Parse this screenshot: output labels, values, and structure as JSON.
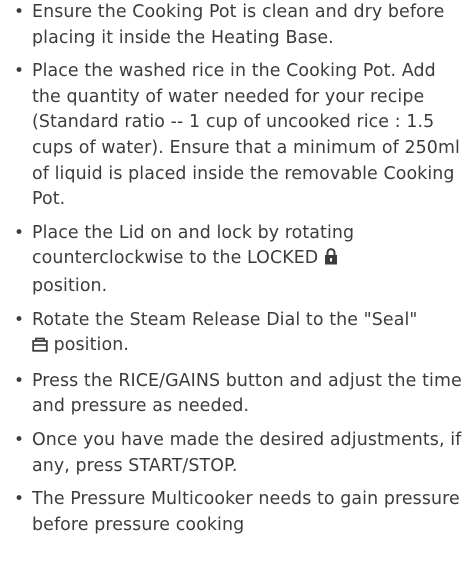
{
  "instructions": [
    {
      "text": "Ensure the Cooking Pot is clean and dry before placing it inside the Heating Base."
    },
    {
      "text": "Place the washed rice in the Cooking Pot. Add the quantity of water needed for your recipe (Standard ratio -- 1 cup of uncooked rice : 1.5 cups of water). Ensure that a minimum of 250ml of liquid is placed inside the removable Cooking Pot."
    },
    {
      "text_before": "Place the Lid on and lock by rotating counterclockwise to the LOCKED",
      "icon": "lock-icon",
      "text_after": "position."
    },
    {
      "text_before": "Rotate the Steam Release Dial to the \"Seal\"",
      "icon": "seal-icon",
      "text_after": "position."
    },
    {
      "text": "Press the RICE/GAINS button and adjust the time and pressure as needed."
    },
    {
      "text": "Once you have made the desired adjustments, if any, press START/STOP."
    },
    {
      "text": "The Pressure Multicooker needs to gain pressure before pressure cooking"
    }
  ],
  "bullet": "•"
}
